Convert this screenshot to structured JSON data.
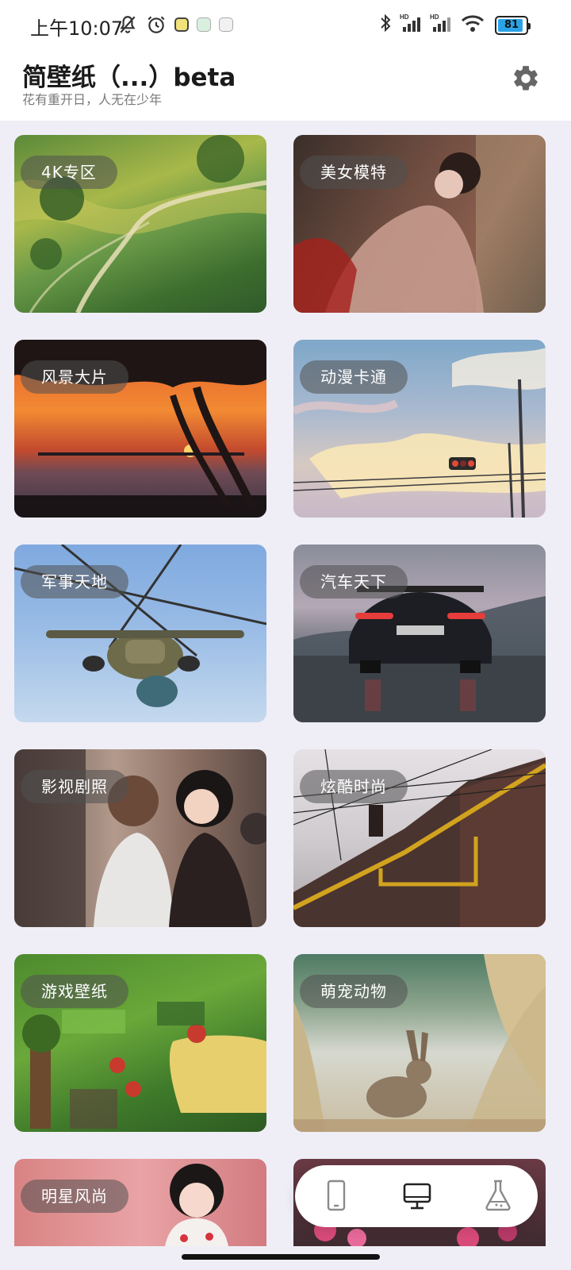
{
  "status_bar": {
    "time": "上午10:07",
    "battery": "81",
    "network_1": "HD",
    "network_2": "HD"
  },
  "header": {
    "title": "简壁纸（...）beta",
    "subtitle": "花有重开日，人无在少年",
    "settings_icon": "gear-icon"
  },
  "categories": [
    {
      "label": "4K专区",
      "theme": "aerial-farmland"
    },
    {
      "label": "美女模特",
      "theme": "woman-portrait"
    },
    {
      "label": "风景大片",
      "theme": "sunset-tree"
    },
    {
      "label": "动漫卡通",
      "theme": "anime-sky"
    },
    {
      "label": "军事天地",
      "theme": "helicopter"
    },
    {
      "label": "汽车天下",
      "theme": "sports-car"
    },
    {
      "label": "影视剧照",
      "theme": "movie-still"
    },
    {
      "label": "炫酷时尚",
      "theme": "brick-building"
    },
    {
      "label": "游戏壁纸",
      "theme": "game-map"
    },
    {
      "label": "萌宠动物",
      "theme": "hare"
    },
    {
      "label": "明星风尚",
      "theme": "celebrity"
    },
    {
      "label": "",
      "theme": "flowers"
    }
  ],
  "bottom_nav": {
    "items": [
      {
        "icon": "phone-icon",
        "active": false
      },
      {
        "icon": "desktop-icon",
        "active": true
      },
      {
        "icon": "flask-icon",
        "active": false
      }
    ]
  },
  "colors": {
    "background": "#efeef6",
    "pill": "rgba(80,80,80,0.55)",
    "battery": "#2aa3e6"
  }
}
